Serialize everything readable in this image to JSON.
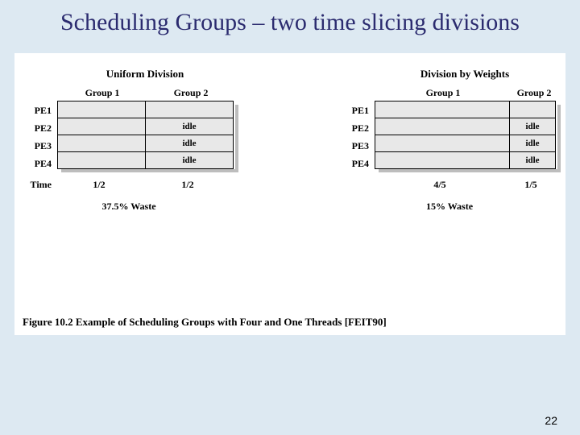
{
  "title": "Scheduling Groups – two time slicing divisions",
  "uniform": {
    "title": "Uniform Division",
    "groups": [
      "Group 1",
      "Group 2"
    ],
    "rows": [
      "PE1",
      "PE2",
      "PE3",
      "PE4"
    ],
    "cells": [
      [
        "",
        ""
      ],
      [
        "",
        "idle"
      ],
      [
        "",
        "idle"
      ],
      [
        "",
        "idle"
      ]
    ],
    "time_label": "Time",
    "time": [
      "1/2",
      "1/2"
    ],
    "waste": "37.5% Waste"
  },
  "weighted": {
    "title": "Division by Weights",
    "groups": [
      "Group 1",
      "Group 2"
    ],
    "rows": [
      "PE1",
      "PE2",
      "PE3",
      "PE4"
    ],
    "cells": [
      [
        "",
        ""
      ],
      [
        "",
        "idle"
      ],
      [
        "",
        "idle"
      ],
      [
        "",
        "idle"
      ]
    ],
    "time": [
      "4/5",
      "1/5"
    ],
    "waste": "15% Waste"
  },
  "caption": "Figure 10.2   Example of Scheduling Groups with Four and One Threads [FEIT90]",
  "page": "22",
  "chart_data": [
    {
      "type": "table",
      "title": "Uniform Division",
      "row_labels": [
        "PE1",
        "PE2",
        "PE3",
        "PE4"
      ],
      "col_labels": [
        "Group 1",
        "Group 2"
      ],
      "col_widths_fraction": [
        0.5,
        0.5
      ],
      "cells": [
        [
          "",
          ""
        ],
        [
          "",
          "idle"
        ],
        [
          "",
          "idle"
        ],
        [
          "",
          "idle"
        ]
      ],
      "time_values": [
        "1/2",
        "1/2"
      ],
      "waste_pct": 37.5
    },
    {
      "type": "table",
      "title": "Division by Weights",
      "row_labels": [
        "PE1",
        "PE2",
        "PE3",
        "PE4"
      ],
      "col_labels": [
        "Group 1",
        "Group 2"
      ],
      "col_widths_fraction": [
        0.8,
        0.2
      ],
      "cells": [
        [
          "",
          ""
        ],
        [
          "",
          "idle"
        ],
        [
          "",
          "idle"
        ],
        [
          "",
          "idle"
        ]
      ],
      "time_values": [
        "4/5",
        "1/5"
      ],
      "waste_pct": 15
    }
  ]
}
